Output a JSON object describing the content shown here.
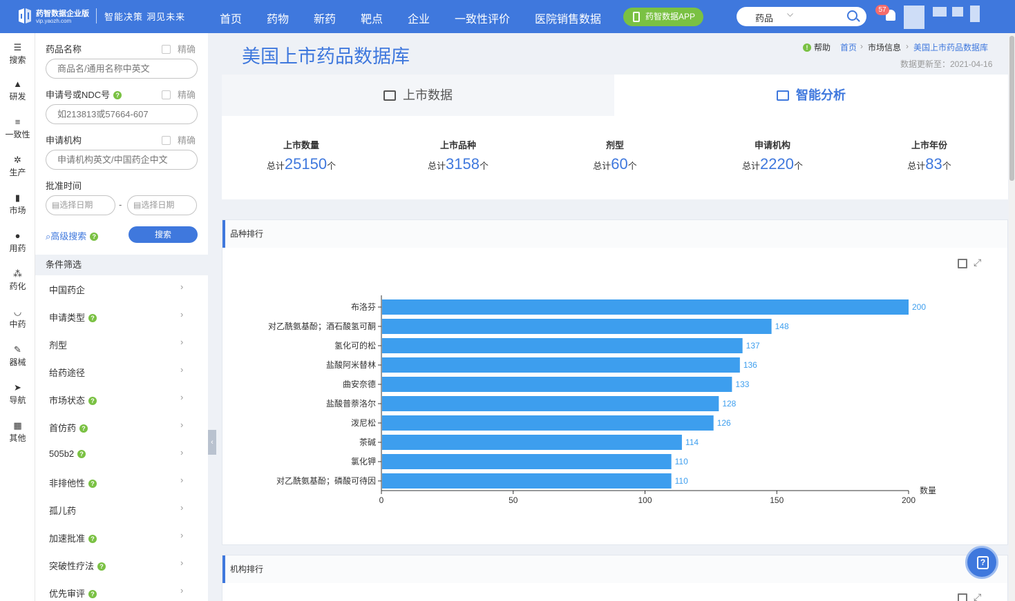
{
  "header": {
    "logo_title": "药智数据企业版",
    "logo_url": "vip.yaozh.com",
    "slogan": "智能决策 洞见未来",
    "nav": [
      "首页",
      "药物",
      "新药",
      "靶点",
      "企业",
      "一致性评价",
      "医院销售数据"
    ],
    "app_button": "药智数据APP",
    "search_select": "药品",
    "notification_count": "57",
    "brand_color": "#3f78dd"
  },
  "iconbar": [
    "搜索",
    "研发",
    "一致性",
    "生产",
    "市场",
    "用药",
    "药化",
    "中药",
    "器械",
    "导航",
    "其他"
  ],
  "filter": {
    "drug_name_label": "药品名称",
    "exact_label": "精确",
    "drug_name_placeholder": "商品名/通用名称中英文",
    "ndc_label": "申请号或NDC号",
    "ndc_placeholder": "如213813或57664-607",
    "org_label": "申请机构",
    "org_placeholder": "申请机构英文/中国药企中文",
    "date_label": "批准时间",
    "date_start_placeholder": "选择日期",
    "date_sep": "-",
    "date_end_placeholder": "选择日期",
    "advanced_search": "高级搜索",
    "search_button": "搜索",
    "conditions_header": "条件筛选",
    "conditions": [
      {
        "label": "中国药企",
        "help": false
      },
      {
        "label": "申请类型",
        "help": true
      },
      {
        "label": "剂型",
        "help": false
      },
      {
        "label": "给药途径",
        "help": false
      },
      {
        "label": "市场状态",
        "help": true
      },
      {
        "label": "首仿药",
        "help": true
      },
      {
        "label": "505b2",
        "help": true
      },
      {
        "label": "非排他性",
        "help": true
      },
      {
        "label": "孤儿药",
        "help": false
      },
      {
        "label": "加速批准",
        "help": true
      },
      {
        "label": "突破性疗法",
        "help": true
      },
      {
        "label": "优先审评",
        "help": true
      }
    ]
  },
  "main": {
    "title": "美国上市药品数据库",
    "help_label": "帮助",
    "breadcrumb": [
      "首页",
      "市场信息",
      "美国上市药品数据库"
    ],
    "updated": "数据更新至：2021-04-16",
    "tabs": [
      "上市数据",
      "智能分析"
    ],
    "stats": [
      {
        "label": "上市数量",
        "prefix": "总计",
        "value": "25150",
        "unit": "个"
      },
      {
        "label": "上市品种",
        "prefix": "总计",
        "value": "3158",
        "unit": "个"
      },
      {
        "label": "剂型",
        "prefix": "总计",
        "value": "60",
        "unit": "个"
      },
      {
        "label": "申请机构",
        "prefix": "总计",
        "value": "2220",
        "unit": "个"
      },
      {
        "label": "上市年份",
        "prefix": "总计",
        "value": "83",
        "unit": "个"
      }
    ],
    "panel1_title": "品种排行",
    "panel2_title": "机构排行"
  },
  "chart_data": {
    "type": "bar",
    "orientation": "horizontal",
    "title": "品种排行",
    "categories": [
      "布洛芬",
      "对乙酰氨基酚；酒石酸氢可酮",
      "氢化可的松",
      "盐酸阿米替林",
      "曲安奈德",
      "盐酸普萘洛尔",
      "泼尼松",
      "茶碱",
      "氯化钾",
      "对乙酰氨基酚；磷酸可待因"
    ],
    "values": [
      200,
      148,
      137,
      136,
      133,
      128,
      126,
      114,
      110,
      110
    ],
    "xlabel": "数量",
    "xlim": [
      0,
      200
    ],
    "ticks": [
      0,
      50,
      100,
      150,
      200
    ],
    "bar_color": "#3d9eee",
    "data_labels": true
  }
}
